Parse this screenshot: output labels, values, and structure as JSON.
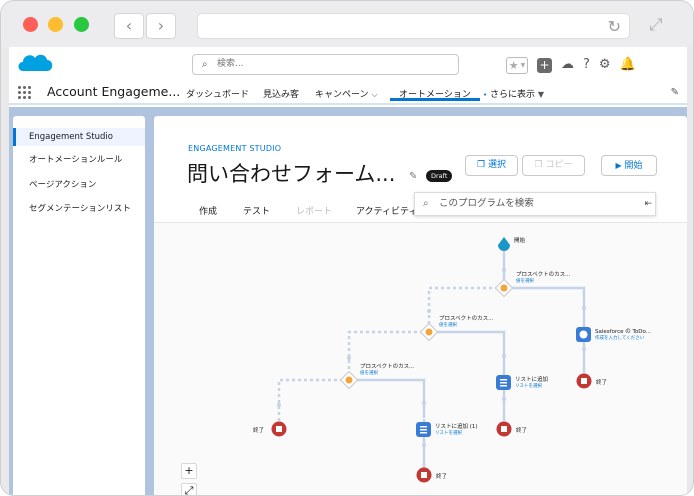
{
  "header": {
    "search_placeholder": "検索...",
    "app_name": "Account Engageme..."
  },
  "nav": {
    "items": [
      "ダッシュボード",
      "見込み客",
      "キャンペーン",
      "オートメーション"
    ],
    "more": "さらに表示"
  },
  "sidebar": {
    "items": [
      "Engagement Studio",
      "オートメーションルール",
      "ページアクション",
      "セグメンテーションリスト"
    ]
  },
  "program": {
    "breadcrumb": "ENGAGEMENT STUDIO",
    "title": "問い合わせフォーム...",
    "badge": "Draft",
    "buttons": {
      "select": "選択",
      "copy": "コピー",
      "start": "開始"
    },
    "tabs": [
      "作成",
      "テスト",
      "レポート",
      "アクティビティ"
    ],
    "search_placeholder": "このプログラムを検索"
  },
  "flow": {
    "start": "開始",
    "rule_label": "プロスペクトのカス...",
    "rule_sub": "値を選択",
    "rule_sub_top": "値を選択",
    "sf_label": "Salesforce の ToDo...",
    "sf_sub": "作成を入力してください",
    "list_label": "リストに追加",
    "list_sub": "リストを選択",
    "list_label_1": "リストに追加 (1)",
    "end": "終了",
    "zoom_in": "+",
    "fit": "⤢"
  },
  "colors": {
    "accent": "#0176d3",
    "end_node": "#c23934",
    "rule_node": "#f4a33a",
    "action_node": "#3a7bd5",
    "start_node": "#1b96c8"
  }
}
